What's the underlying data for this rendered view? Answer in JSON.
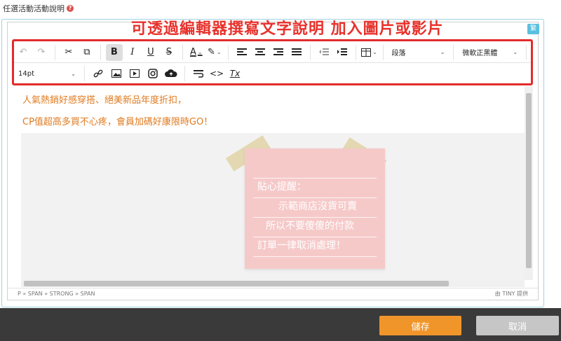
{
  "field": {
    "label": "任選活動活動說明",
    "help": "?"
  },
  "banner": "可透過編輯器撰寫文字說明 加入圖片或影片",
  "lang_badge": "繁",
  "toolbar": {
    "undo": "↶",
    "redo": "↷",
    "cut": "✂",
    "copy": "⧉",
    "bold": "B",
    "italic": "I",
    "underline": "U",
    "strike": "S",
    "font_color": "A",
    "highlight": "✎",
    "block_format": "段落",
    "font_family": "微軟正黑體",
    "font_size": "14pt",
    "link": "🔗",
    "image": "▣",
    "media": "▶",
    "instagram": "◎",
    "cloud": "☁",
    "wrap": "↩",
    "code": "<>",
    "clear_format": "Tx"
  },
  "content": {
    "line1": "人氣熱銷好感穿搭、絕美新品年度折扣，",
    "line2": "CP值超高多買不心疼，會員加碼好康限時GO！",
    "sticky_title": "貼心提醒：",
    "sticky_line1": "示範商店沒貨可賣",
    "sticky_line2": "所以不要傻傻的付款",
    "sticky_line3": "訂單一律取消處理！"
  },
  "status": {
    "path": "P » SPAN » STRONG » SPAN",
    "brand": "由 TINY 提供"
  },
  "buttons": {
    "save": "儲存",
    "cancel": "取消"
  },
  "colors": {
    "accent": "#f0952a",
    "highlight_border": "#e32b2b",
    "text_orange": "#e07a1f",
    "banner": "#e8312b"
  }
}
